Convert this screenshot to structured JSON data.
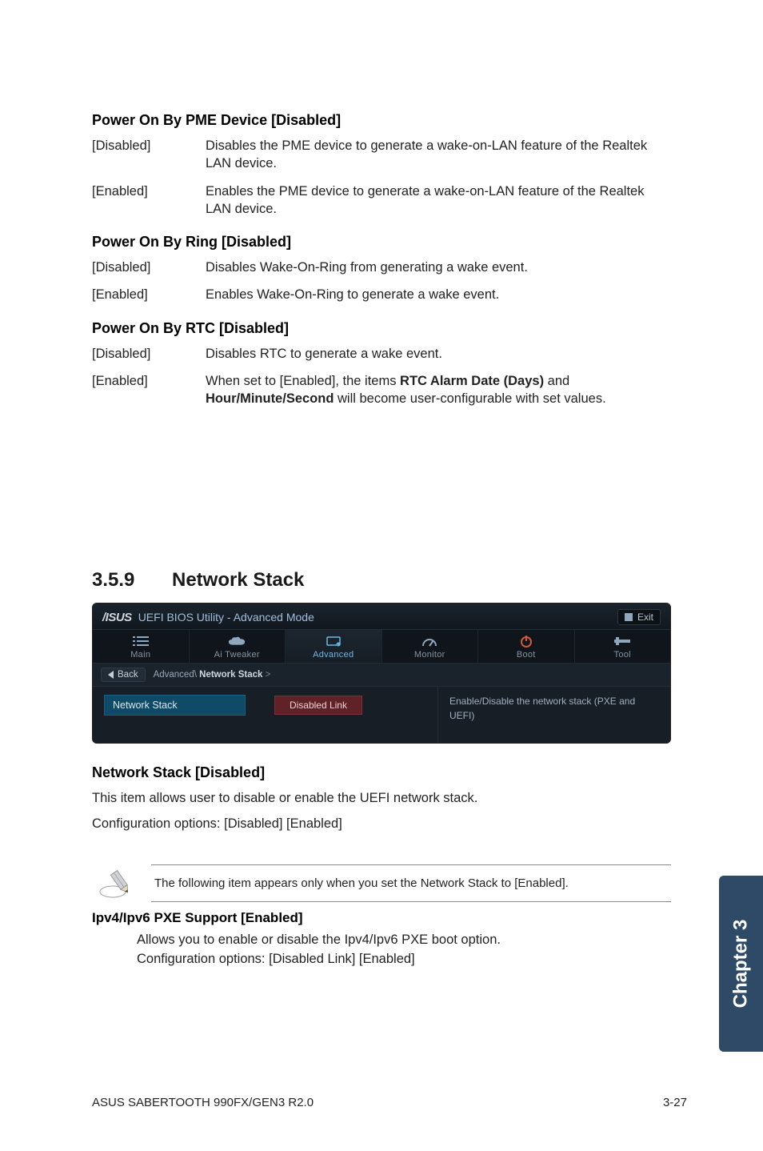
{
  "sections": {
    "pme": {
      "heading": "Power On By PME Device [Disabled]",
      "rows": [
        {
          "label": "[Disabled]",
          "desc": "Disables the PME device to generate a wake-on-LAN feature of the Realtek LAN device."
        },
        {
          "label": "[Enabled]",
          "desc": "Enables the PME device to generate a wake-on-LAN feature of the Realtek LAN device."
        }
      ]
    },
    "ring": {
      "heading": "Power On By Ring [Disabled]",
      "rows": [
        {
          "label": "[Disabled]",
          "desc": "Disables Wake-On-Ring from generating a wake event."
        },
        {
          "label": "[Enabled]",
          "desc": "Enables Wake-On-Ring to generate a wake event."
        }
      ]
    },
    "rtc": {
      "heading": "Power On By RTC [Disabled]",
      "rows": [
        {
          "label": "[Disabled]",
          "desc": "Disables RTC to generate a wake event."
        },
        {
          "label": "[Enabled]",
          "desc_prefix": "When set to [Enabled], the items ",
          "b1": "RTC Alarm Date (Days)",
          "mid": " and ",
          "b2": "Hour/Minute/Second",
          "desc_suffix": " will become user-configurable with set values."
        }
      ]
    }
  },
  "h2": {
    "num": "3.5.9",
    "title": "Network Stack"
  },
  "bios": {
    "brand_text": "/ISUS",
    "title": "UEFI BIOS Utility - Advanced Mode",
    "exit": "Exit",
    "tabs": [
      {
        "name": "main",
        "label": "Main"
      },
      {
        "name": "ai-tweaker",
        "label": "Ai Tweaker"
      },
      {
        "name": "advanced",
        "label": "Advanced"
      },
      {
        "name": "monitor",
        "label": "Monitor"
      },
      {
        "name": "boot",
        "label": "Boot"
      },
      {
        "name": "tool",
        "label": "Tool"
      }
    ],
    "back": "Back",
    "crumb_parent": "Advanced\\",
    "crumb_leaf": "Network Stack",
    "crumb_tail": ">",
    "row_label": "Network Stack",
    "row_value": "Disabled Link",
    "help": "Enable/Disable the network stack (PXE and UEFI)"
  },
  "netstack": {
    "heading": "Network Stack [Disabled]",
    "p1": "This item allows user to disable or enable the UEFI network stack.",
    "p2": "Configuration options: [Disabled] [Enabled]"
  },
  "note": "The following item appears only when you set the Network Stack to [Enabled].",
  "pxe": {
    "heading": "Ipv4/Ipv6 PXE Support [Enabled]",
    "line1": "Allows you to enable or disable the Ipv4/Ipv6 PXE boot option.",
    "line2": "Configuration options: [Disabled Link] [Enabled]"
  },
  "sidetab": "Chapter 3",
  "footer": {
    "left": "ASUS SABERTOOTH 990FX/GEN3 R2.0",
    "right": "3-27"
  }
}
